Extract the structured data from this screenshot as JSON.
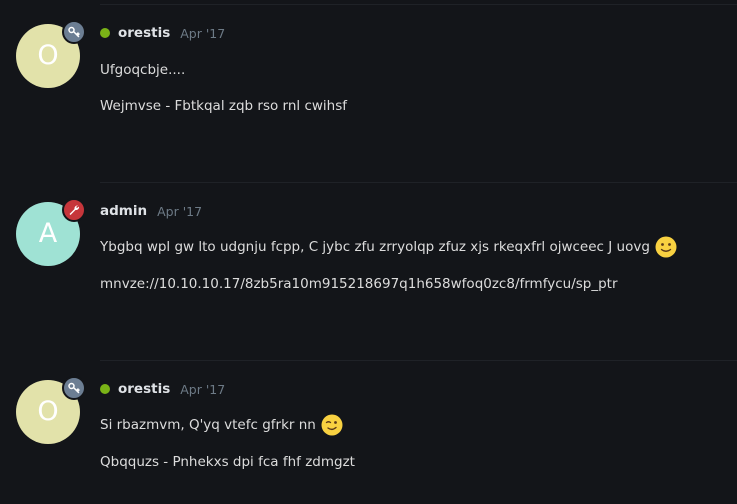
{
  "colors": {
    "background": "#131519",
    "online": "#7ab317",
    "avatar_o": "#e2e2aa",
    "avatar_a": "#9fe2d4",
    "flair_key": "#6c7e93",
    "flair_wrench": "#c6363b"
  },
  "posts": [
    {
      "avatar_letter": "O",
      "flair_icon": "key-icon",
      "online": true,
      "username": "orestis",
      "date": "Apr '17",
      "lines": [
        "Ufgoqcbje....",
        "Wejmvse - Fbtkqal zqb rso rnl cwihsf"
      ]
    },
    {
      "avatar_letter": "A",
      "flair_icon": "wrench-icon",
      "online": false,
      "username": "admin",
      "date": "Apr '17",
      "lines": [
        "Ybgbq wpl gw lto udgnju fcpp, C jybc zfu zrryolqp zfuz xjs rkeqxfrl ojwceec J uovg",
        "mnvze://10.10.10.17/8zb5ra10m915218697q1h658wfoq0zc8/frmfycu/sp_ptr"
      ],
      "emoji": "slightly-smiling-face-icon"
    },
    {
      "avatar_letter": "O",
      "flair_icon": "key-icon",
      "online": true,
      "username": "orestis",
      "date": "Apr '17",
      "lines": [
        "Si rbazmvm, Q'yq vtefc gfrkr nn",
        "Qbqquzs - Pnhekxs dpi fca fhf zdmgzt"
      ],
      "emoji": "winking-face-icon"
    }
  ]
}
